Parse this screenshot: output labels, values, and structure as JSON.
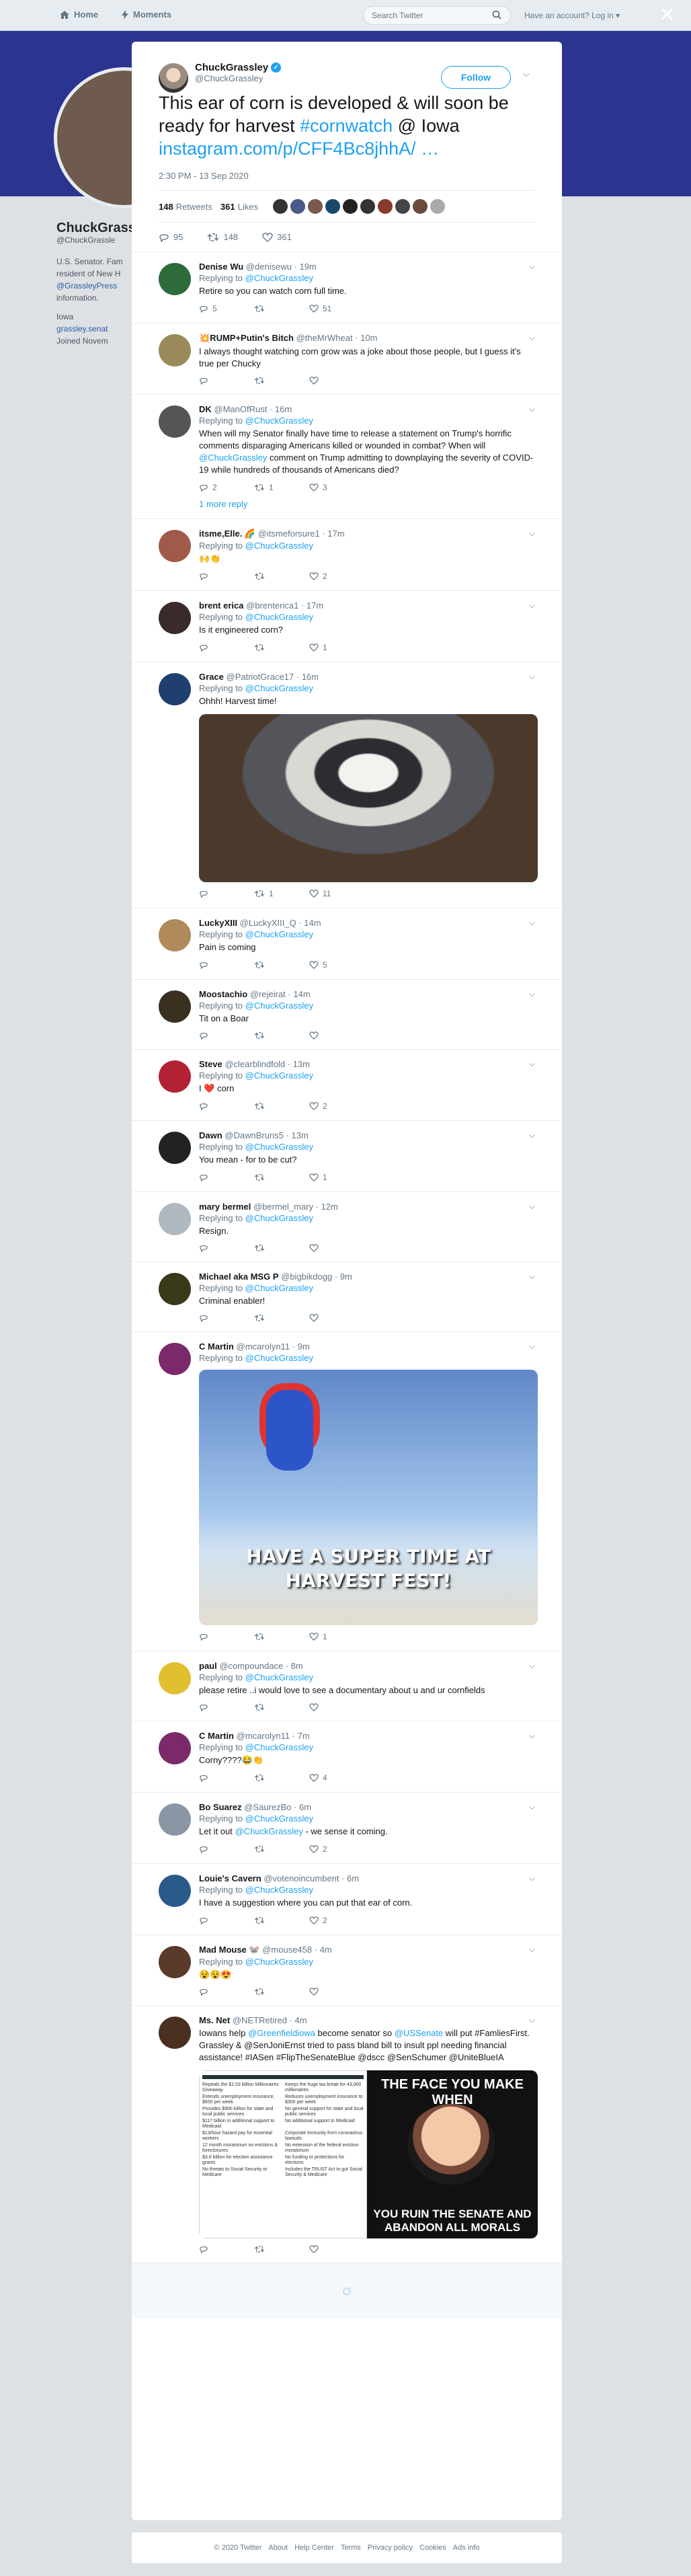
{
  "nav": {
    "home": "Home",
    "moments": "Moments",
    "search_placeholder": "Search Twitter",
    "account_prompt": "Have an account? Log in ▾"
  },
  "background_profile": {
    "name": "ChuckGrassl",
    "handle": "@ChuckGrassle",
    "bio1": "U.S. Senator. Fam",
    "bio2": "resident of New H",
    "bio3": "@GrassleyPress",
    "bio4": "information.",
    "location": "Iowa",
    "website": "grassley.senat",
    "joined": "Joined Novem"
  },
  "tweet": {
    "name": "ChuckGrassley",
    "handle": "@ChuckGrassley",
    "follow_label": "Follow",
    "text_main": "This ear of corn is developed & will soon be ready for harvest ",
    "hashtag": "#cornwatch",
    "text_loc": " @ Iowa",
    "link": "instagram.com/p/CFF4Bc8jhhA/ …",
    "time": "2:30 PM - 13 Sep 2020",
    "retweets": "148",
    "retweets_label": "Retweets",
    "likes": "361",
    "likes_label": "Likes",
    "reply_count": "95",
    "retweet_count": "148",
    "like_count": "361"
  },
  "likers_colors": [
    "#333",
    "#4a5a8a",
    "#7a5a4a",
    "#1a4a6a",
    "#222",
    "#333",
    "#8a3a2a",
    "#444",
    "#6a4a3a",
    "#aaa"
  ],
  "replying_to": "Replying to ",
  "replies": [
    {
      "name": "Denise Wu",
      "handle": "@denisewu",
      "time": "19m",
      "to": "@ChuckGrassley",
      "text": "Retire so you can watch corn full time.",
      "reply": "5",
      "rt": "",
      "like": "51",
      "color": "#2d6b3b"
    },
    {
      "name": "💥RUMP+Putin's Bitch",
      "handle": "@theMrWheat",
      "time": "10m",
      "to": "",
      "text": "I always thought watching corn grow was a joke about those people, but I guess it's true per Chucky",
      "reply": "",
      "rt": "",
      "like": "",
      "color": "#9a8a5a"
    },
    {
      "name": "DK",
      "handle": "@ManOfRust",
      "time": "16m",
      "to": "@ChuckGrassley",
      "text": "When will my Senator finally have time to release a statement on Trump's horrific comments disparaging Americans killed or wounded in combat? When will ",
      "mention": "@ChuckGrassley",
      "text2": " comment on Trump admitting to downplaying the severity of COVID-19 while hundreds of thousands of Americans died?",
      "reply": "2",
      "rt": "1",
      "like": "3",
      "color": "#555",
      "more": "1 more reply"
    },
    {
      "name": "itsme,Elle. 🌈",
      "handle": "@itsmeforsure1",
      "time": "17m",
      "to": "@ChuckGrassley",
      "text": "🙌👏",
      "reply": "",
      "rt": "",
      "like": "2",
      "color": "#a05a4a"
    },
    {
      "name": "brent erica",
      "handle": "@brenterica1",
      "time": "17m",
      "to": "@ChuckGrassley",
      "text": "Is it engineered corn?",
      "reply": "",
      "rt": "",
      "like": "1",
      "color": "#3a2a2a"
    },
    {
      "name": "Grace",
      "handle": "@PatriotGrace17",
      "time": "16m",
      "to": "@ChuckGrassley",
      "text": "Ohhh! Harvest time!",
      "reply": "",
      "rt": "1",
      "like": "11",
      "color": "#1f3f6f"
    },
    {
      "name": "LuckyXIII",
      "handle": "@LuckyXIII_Q",
      "time": "14m",
      "to": "@ChuckGrassley",
      "text": "Pain is coming",
      "reply": "",
      "rt": "",
      "like": "5",
      "color": "#b08a5a"
    },
    {
      "name": "Moostachio",
      "handle": "@rejeirat",
      "time": "14m",
      "to": "@ChuckGrassley",
      "text": "Tit on a Boar",
      "reply": "",
      "rt": "",
      "like": "",
      "color": "#3a3020"
    },
    {
      "name": "Steve",
      "handle": "@clearblindfold",
      "time": "13m",
      "to": "@ChuckGrassley",
      "text": "I ❤️ corn",
      "reply": "",
      "rt": "",
      "like": "2",
      "color": "#b22234"
    },
    {
      "name": "Dawn",
      "handle": "@DawnBruns5",
      "time": "13m",
      "to": "@ChuckGrassley",
      "text": "You mean - for to be cut?",
      "reply": "",
      "rt": "",
      "like": "1",
      "color": "#222"
    },
    {
      "name": "mary bermel",
      "handle": "@bermel_mary",
      "time": "12m",
      "to": "@ChuckGrassley",
      "text": "Resign.",
      "reply": "",
      "rt": "",
      "like": "",
      "color": "#b0b8c0"
    },
    {
      "name": "Michael aka MSG P",
      "handle": "@bigbikdogg",
      "time": "9m",
      "to": "@ChuckGrassley",
      "text": "Criminal enabler!",
      "reply": "",
      "rt": "",
      "like": "",
      "color": "#3a3a1a"
    },
    {
      "name": "C Martin",
      "handle": "@mcarolyn11",
      "time": "9m",
      "to": "@ChuckGrassley",
      "text": "",
      "reply": "",
      "rt": "",
      "like": "1",
      "color": "#7a2a6a"
    },
    {
      "name": "paul",
      "handle": "@compoundace",
      "time": "8m",
      "to": "@ChuckGrassley",
      "text": "please retire ..i would love to see a documentary about u and ur cornfields",
      "reply": "",
      "rt": "",
      "like": "",
      "color": "#e0c030"
    },
    {
      "name": "C Martin",
      "handle": "@mcarolyn11",
      "time": "7m",
      "to": "@ChuckGrassley",
      "text": "Corny????😂👏",
      "reply": "",
      "rt": "",
      "like": "4",
      "color": "#7a2a6a"
    },
    {
      "name": "Bo Suarez",
      "handle": "@SaurezBo",
      "time": "6m",
      "to": "@ChuckGrassley",
      "text": "Let it out ",
      "mention": "@ChuckGrassley",
      "text2": " - we sense it coming.",
      "reply": "",
      "rt": "",
      "like": "2",
      "color": "#8a96a3"
    },
    {
      "name": "Louie's Cavern",
      "handle": "@votenoincumbent",
      "time": "6m",
      "to": "@ChuckGrassley",
      "text": "I have a suggestion where you can put that ear of corn.",
      "reply": "",
      "rt": "",
      "like": "2",
      "color": "#2a5a8a"
    },
    {
      "name": "Mad Mouse 🐭",
      "handle": "@mouse458",
      "time": "4m",
      "to": "@ChuckGrassley",
      "text": "😵😵😍",
      "reply": "",
      "rt": "",
      "like": "",
      "color": "#5a3a2a"
    },
    {
      "name": "Ms. Net",
      "handle": "@NETRetired",
      "time": "4m",
      "to": "",
      "text": "Iowans help ",
      "mention": "@Greenfieldiowa",
      "text2": " become senator so ",
      "mention2": "@USSenate",
      "text3": " will put #FamliesFirst. Grassley & @SenJoniErnst tried to pass bland bill to insult ppl needing financial assistance! #IASen #FlipTheSenateBlue @dscc @SenSchumer @UniteBlueIA",
      "reply": "",
      "rt": "",
      "like": "",
      "color": "#4a3020"
    }
  ],
  "gif_caption": "HAVE A SUPER TIME AT HARVEST FEST!",
  "collage_right_top": "THE FACE YOU MAKE WHEN",
  "collage_right_bottom": "YOU RUIN THE SENATE AND ABANDON ALL MORALS",
  "collage_left_rows": [
    "Repeals the $1.53 billion Millionaires Giveaway",
    "Keeps the huge tax break for 43,000 millionaires",
    "Extends unemployment insurance, $600 per week",
    "Reduces unemployment insurance to $300 per week",
    "Provides $900 billion for state and local public services",
    "No general support for state and local public services",
    "$117 billion in additional support to Medicaid",
    "No additional support to Medicaid",
    "$13/hour hazard pay for essential workers",
    "Corporate immunity from coronavirus lawsuits",
    "12 month moratorium on evictions & foreclosures",
    "No extension of the federal eviction moratorium",
    "$3.6 billion for election assistance grants",
    "No funding or protections for elections",
    "No threats to Social Security or Medicare",
    "Includes the TRUST Act to gut Social Security & Medicare"
  ],
  "footer": [
    "© 2020 Twitter",
    "About",
    "Help Center",
    "Terms",
    "Privacy policy",
    "Cookies",
    "Ads info"
  ]
}
